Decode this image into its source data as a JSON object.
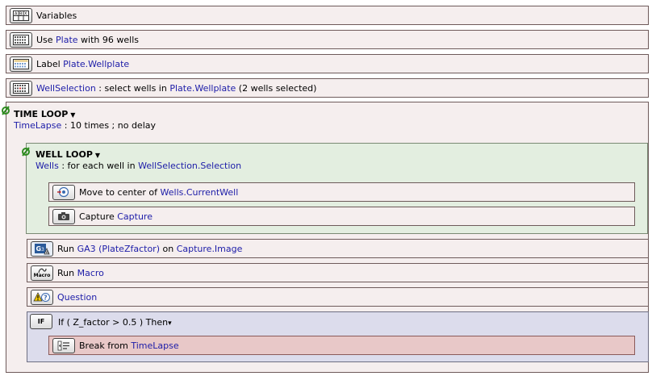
{
  "steps": {
    "variables": {
      "label": "Variables"
    },
    "use_plate": {
      "prefix": "Use ",
      "plate": "Plate",
      "suffix": " with 96 wells"
    },
    "label_plate": {
      "prefix": "Label ",
      "target": "Plate.Wellplate"
    },
    "well_selection": {
      "name": "WellSelection",
      "middle": " : select wells in ",
      "target": "Plate.Wellplate",
      "suffix": " (2 wells selected)"
    }
  },
  "time_loop": {
    "title": "TIME LOOP",
    "caret": "▼",
    "var": "TimeLapse",
    "desc": " : 10 times ; no delay"
  },
  "well_loop": {
    "title": "WELL LOOP",
    "caret": "▼",
    "var": "Wells",
    "middle": " : for each well in ",
    "source": "WellSelection.Selection",
    "steps": {
      "move": {
        "prefix": "Move to center of ",
        "target": "Wells.CurrentWell"
      },
      "capture": {
        "prefix": "Capture ",
        "target": "Capture"
      }
    }
  },
  "after_loop": {
    "run_ga3": {
      "prefix": "Run ",
      "recipe": "GA3 (PlateZfactor)",
      "middle": " on ",
      "target": "Capture.Image"
    },
    "run_macro": {
      "prefix": "Run ",
      "target": "Macro"
    },
    "question": {
      "label": "Question"
    }
  },
  "if_block": {
    "icon_text": "IF",
    "condition": "If ( Z_factor > 0.5 ) Then",
    "caret": "▾",
    "break": {
      "prefix": "Break from ",
      "target": "TimeLapse"
    }
  },
  "icons": {
    "macro_label": "Macro"
  },
  "colors": {
    "link": "#1c1ca8",
    "step_bg": "#f5eeee",
    "well_loop_bg": "#e3eee0",
    "if_bg": "#dcdcec",
    "break_bg": "#e8c8c8",
    "loop_icon": "#2e8b20"
  }
}
